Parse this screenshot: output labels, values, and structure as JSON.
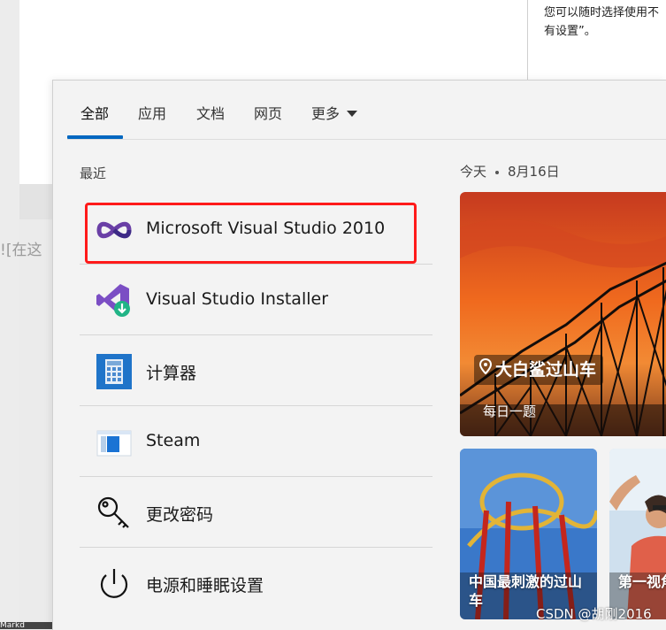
{
  "background": {
    "left_alt_text": "![在这",
    "right_text": "您可以随时选择使用不有设置”。",
    "bottom_text": "Markd"
  },
  "tabs": [
    {
      "label": "全部",
      "active": true
    },
    {
      "label": "应用"
    },
    {
      "label": "文档"
    },
    {
      "label": "网页"
    },
    {
      "label": "更多"
    }
  ],
  "recent": {
    "label": "最近",
    "items": [
      {
        "label": "Microsoft Visual Studio 2010",
        "icon": "visual-studio-2010-icon"
      },
      {
        "label": "Visual Studio Installer",
        "icon": "visual-studio-installer-icon"
      },
      {
        "label": "计算器",
        "icon": "calculator-icon"
      },
      {
        "label": "Steam",
        "icon": "steam-window-icon"
      },
      {
        "label": "更改密码",
        "icon": "key-icon"
      },
      {
        "label": "电源和睡眠设置",
        "icon": "power-icon"
      }
    ]
  },
  "today": {
    "label": "今天",
    "date": "8月16日",
    "feature_card": {
      "title": "大白鲨过山车",
      "subtitle": "每日一题"
    },
    "cards": [
      {
        "title": "中国最刺激的过山车"
      },
      {
        "title": "第一视角车"
      }
    ]
  },
  "watermark": "CSDN @胡刚2016",
  "colors": {
    "accent": "#0067c0",
    "highlight": "#ff1a1a"
  }
}
